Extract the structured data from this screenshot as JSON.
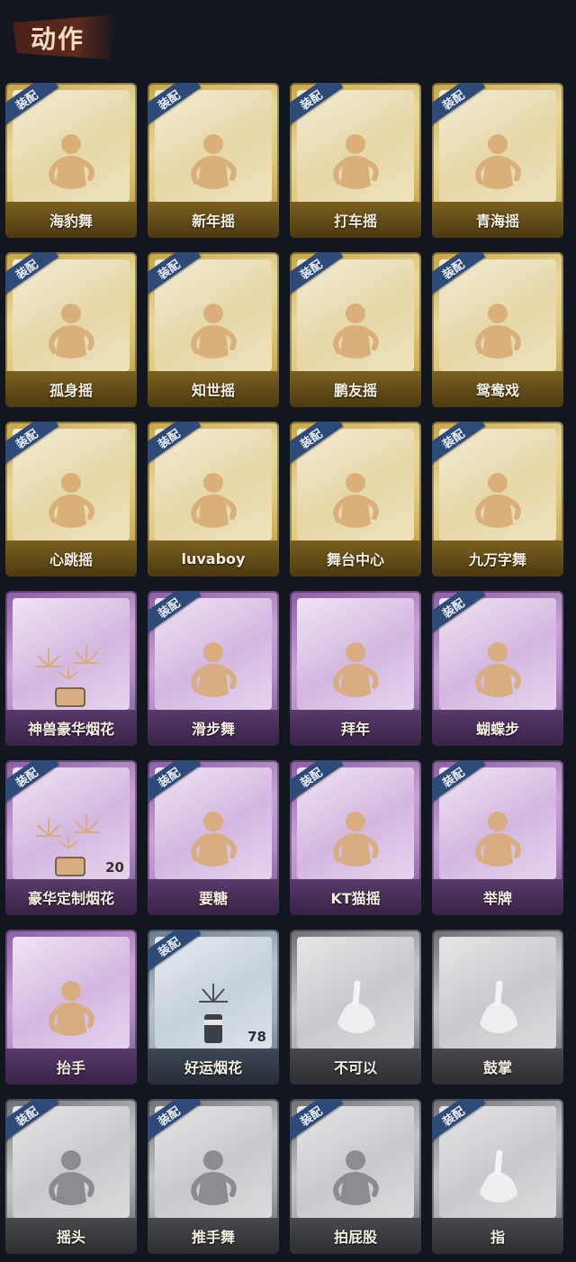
{
  "header": {
    "title": "动作"
  },
  "equip_label": "装配",
  "colors": {
    "gold": "#dfc878",
    "purple": "#b48ac8",
    "blue": "#9eabb9",
    "grey": "#a8a9ad",
    "equip_tag": "#2e4a78"
  },
  "actions": [
    {
      "name": "海豹舞",
      "tier": "gold",
      "equipped": true,
      "icon": "dance-figure-icon"
    },
    {
      "name": "新年摇",
      "tier": "gold",
      "equipped": true,
      "icon": "dance-figure-icon"
    },
    {
      "name": "打车摇",
      "tier": "gold",
      "equipped": true,
      "icon": "dance-figure-icon"
    },
    {
      "name": "青海摇",
      "tier": "gold",
      "equipped": true,
      "icon": "dance-figure-icon"
    },
    {
      "name": "孤身摇",
      "tier": "gold",
      "equipped": true,
      "icon": "dance-figure-icon"
    },
    {
      "name": "知世摇",
      "tier": "gold",
      "equipped": true,
      "icon": "dance-figure-icon"
    },
    {
      "name": "鹏友摇",
      "tier": "gold",
      "equipped": true,
      "icon": "dance-figure-icon"
    },
    {
      "name": "鸳鸯戏",
      "tier": "gold",
      "equipped": true,
      "icon": "dance-figure-icon"
    },
    {
      "name": "心跳摇",
      "tier": "gold",
      "equipped": true,
      "icon": "dance-figure-icon"
    },
    {
      "name": "luvaboy",
      "tier": "gold",
      "equipped": true,
      "icon": "dance-figure-icon"
    },
    {
      "name": "舞台中心",
      "tier": "gold",
      "equipped": true,
      "icon": "dance-figure-icon"
    },
    {
      "name": "九万字舞",
      "tier": "gold",
      "equipped": true,
      "icon": "dance-figure-icon"
    },
    {
      "name": "神兽豪华烟花",
      "tier": "purple",
      "equipped": false,
      "icon": "fireworks-icon"
    },
    {
      "name": "滑步舞",
      "tier": "purple",
      "equipped": true,
      "icon": "dance-figure-icon"
    },
    {
      "name": "拜年",
      "tier": "purple",
      "equipped": false,
      "icon": "bow-figure-icon"
    },
    {
      "name": "蝴蝶步",
      "tier": "purple",
      "equipped": true,
      "icon": "dance-figure-icon"
    },
    {
      "name": "豪华定制烟花",
      "tier": "purple",
      "equipped": true,
      "icon": "fireworks-box-icon",
      "count": "20"
    },
    {
      "name": "要糖",
      "tier": "purple",
      "equipped": true,
      "icon": "candy-figure-icon"
    },
    {
      "name": "KT猫摇",
      "tier": "purple",
      "equipped": true,
      "icon": "dance-figure-icon"
    },
    {
      "name": "举牌",
      "tier": "purple",
      "equipped": true,
      "icon": "sign-figure-icon"
    },
    {
      "name": "抬手",
      "tier": "purple",
      "equipped": false,
      "icon": "raise-hand-figure-icon"
    },
    {
      "name": "好运烟花",
      "tier": "blue",
      "equipped": true,
      "icon": "firework-tube-icon",
      "count": "78"
    },
    {
      "name": "不可以",
      "tier": "grey",
      "equipped": false,
      "icon": "finger-wag-icon"
    },
    {
      "name": "鼓掌",
      "tier": "grey",
      "equipped": false,
      "icon": "clapping-hands-icon"
    },
    {
      "name": "摇头",
      "tier": "grey",
      "equipped": true,
      "icon": "head-shake-figure-icon"
    },
    {
      "name": "推手舞",
      "tier": "grey",
      "equipped": true,
      "icon": "push-hands-figure-icon"
    },
    {
      "name": "拍屁股",
      "tier": "grey",
      "equipped": true,
      "icon": "butt-slap-figure-icon"
    },
    {
      "name": "指",
      "tier": "grey",
      "equipped": true,
      "icon": "pointing-hand-icon"
    }
  ]
}
